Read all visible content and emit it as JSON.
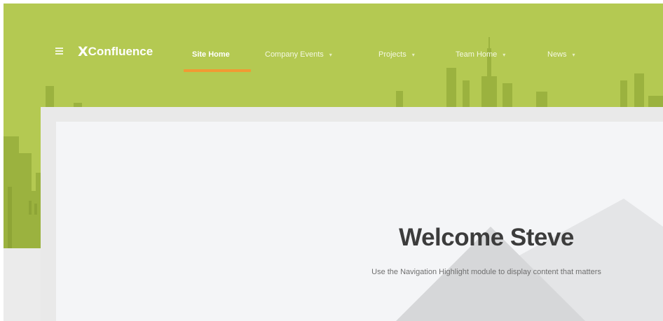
{
  "app": {
    "logo_mark": "X",
    "logo_text": "Confluence"
  },
  "nav": {
    "items": [
      {
        "label": "Site Home",
        "active": true,
        "has_dropdown": false
      },
      {
        "label": "Company Events",
        "active": false,
        "has_dropdown": true
      },
      {
        "label": "Projects",
        "active": false,
        "has_dropdown": true
      },
      {
        "label": "Team Home",
        "active": false,
        "has_dropdown": true
      },
      {
        "label": "News",
        "active": false,
        "has_dropdown": true
      }
    ],
    "dropdown_caret": "▾"
  },
  "hero": {
    "title": "Welcome Steve",
    "subtitle": "Use the Navigation Highlight module to display content that matters"
  },
  "icons": {
    "menu": "hamburger-menu-icon",
    "dropdown": "chevron-down-icon"
  },
  "colors": {
    "header_green": "#b4c952",
    "skyline_green": "#8ea536",
    "active_underline": "#f19a33",
    "card_background": "#f4f5f7",
    "title_text": "#3c3c3c"
  }
}
